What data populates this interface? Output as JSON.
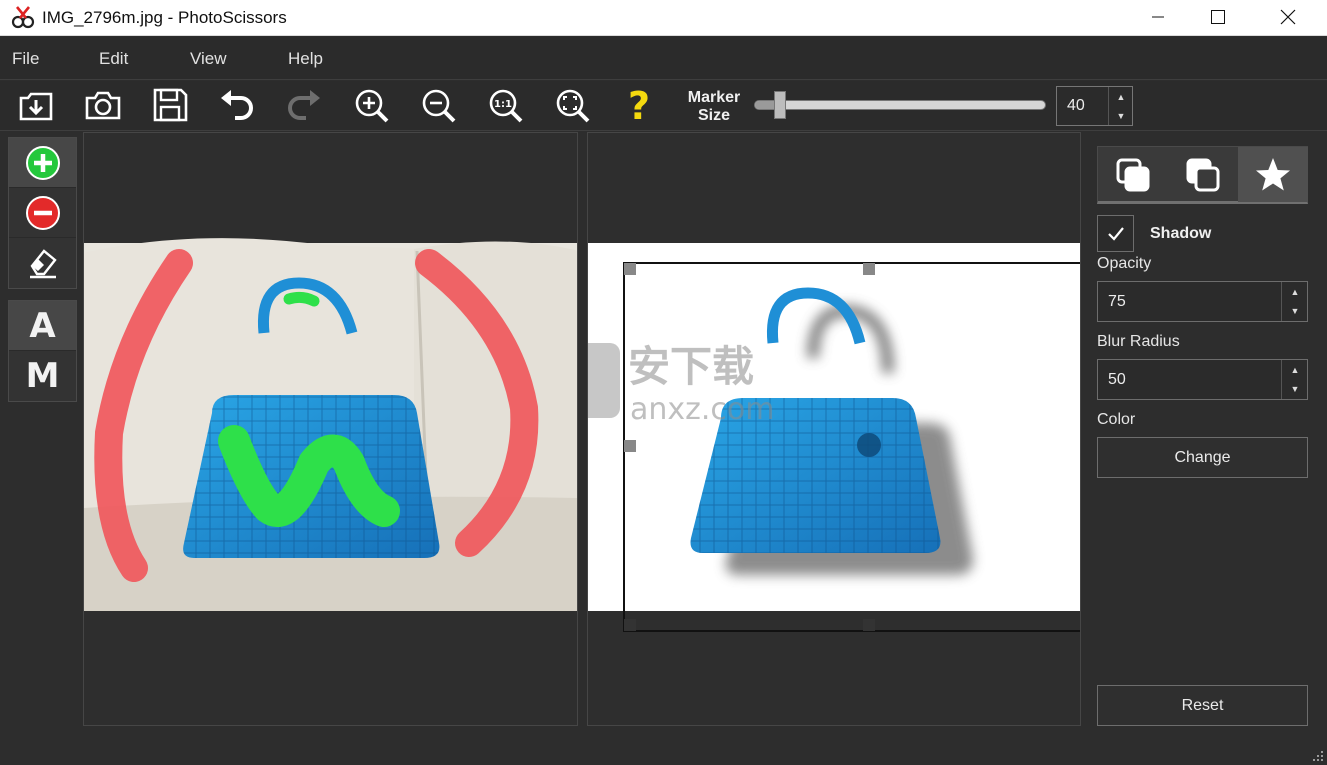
{
  "window": {
    "title": "IMG_2796m.jpg - PhotoScissors"
  },
  "menu": {
    "items": [
      "File",
      "Edit",
      "View",
      "Help"
    ]
  },
  "toolbar": {
    "buttons": [
      {
        "name": "open-icon"
      },
      {
        "name": "camera-icon"
      },
      {
        "name": "save-icon"
      },
      {
        "name": "undo-icon"
      },
      {
        "name": "redo-icon",
        "disabled": true
      },
      {
        "name": "zoom-in-icon"
      },
      {
        "name": "zoom-out-icon"
      },
      {
        "name": "actual-size-icon",
        "text": "1:1"
      },
      {
        "name": "fit-window-icon"
      },
      {
        "name": "help-icon",
        "text": "?"
      }
    ],
    "marker_label_line1": "Marker",
    "marker_label_line2": "Size",
    "marker_size": {
      "value": "40",
      "fraction": 0.09
    }
  },
  "tools": {
    "group1": [
      {
        "name": "add-marker-icon",
        "active": true
      },
      {
        "name": "remove-marker-icon"
      },
      {
        "name": "eraser-icon"
      }
    ],
    "group2": [
      {
        "label": "A"
      },
      {
        "label": "M"
      }
    ]
  },
  "watermark": {
    "line1": "安下载",
    "line2": "anxz.com"
  },
  "sidebar": {
    "tabs": [
      {
        "name": "background-tab-icon"
      },
      {
        "name": "foreground-tab-icon"
      },
      {
        "name": "effects-tab-icon",
        "active": true
      }
    ],
    "shadow_label": "Shadow",
    "shadow_checked": true,
    "opacity_label": "Opacity",
    "opacity_value": "75",
    "blur_label": "Blur Radius",
    "blur_value": "50",
    "color_label": "Color",
    "change_label": "Change",
    "reset_label": "Reset"
  },
  "colors": {
    "marker_red": "#f0585c",
    "marker_green": "#2ee04a",
    "bag_blue": "#1d8ed0",
    "help_yellow": "#f4d90f"
  }
}
